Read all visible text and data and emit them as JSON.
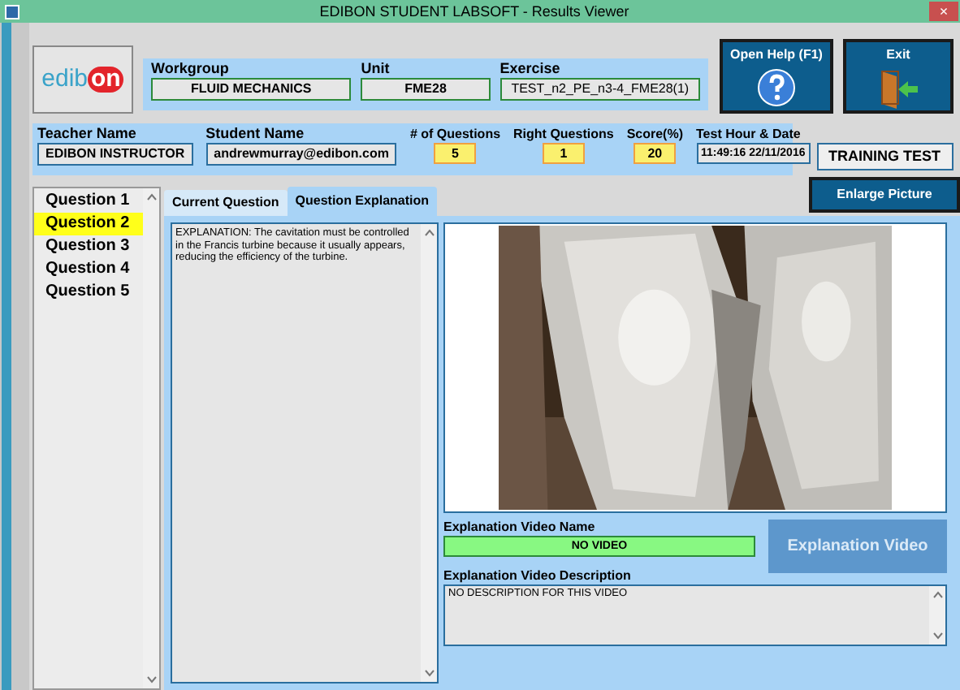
{
  "window": {
    "title": "EDIBON STUDENT LABSOFT - Results Viewer",
    "close": "×"
  },
  "logo": {
    "text": "edib",
    "highlight": "on"
  },
  "info": {
    "workgroup": {
      "label": "Workgroup",
      "value": "FLUID MECHANICS"
    },
    "unit": {
      "label": "Unit",
      "value": "FME28"
    },
    "exercise": {
      "label": "Exercise",
      "value": "TEST_n2_PE_n3-4_FME28(1)"
    }
  },
  "buttons": {
    "help": "Open Help (F1)",
    "exit": "Exit",
    "enlarge": "Enlarge Picture"
  },
  "results": {
    "teacher": {
      "label": "Teacher Name",
      "value": "EDIBON INSTRUCTOR"
    },
    "student": {
      "label": "Student Name",
      "value": "andrewmurray@edibon.com"
    },
    "questions": {
      "label": "# of Questions",
      "value": "5"
    },
    "right": {
      "label": "Right Questions",
      "value": "1"
    },
    "score": {
      "label": "Score(%)",
      "value": "20"
    },
    "date": {
      "label": "Test Hour & Date",
      "value": "11:49:16 22/11/2016"
    }
  },
  "mode": "TRAINING TEST",
  "questions": [
    {
      "label": "Question 1",
      "selected": false
    },
    {
      "label": "Question 2",
      "selected": true
    },
    {
      "label": "Question 3",
      "selected": false
    },
    {
      "label": "Question 4",
      "selected": false
    },
    {
      "label": "Question 5",
      "selected": false
    }
  ],
  "tabs": [
    {
      "label": "Current Question",
      "selected": false
    },
    {
      "label": "Question Explanation",
      "selected": true
    }
  ],
  "explanation": "EXPLANATION:  The cavitation must be controlled in the Francis turbine because it usually appears, reducing the efficiency of the turbine.",
  "video": {
    "name_label": "Explanation Video Name",
    "name": "NO VIDEO",
    "button": "Explanation Video",
    "button_disabled": true,
    "description_label": "Explanation Video Description",
    "description": "NO DESCRIPTION FOR THIS VIDEO"
  }
}
